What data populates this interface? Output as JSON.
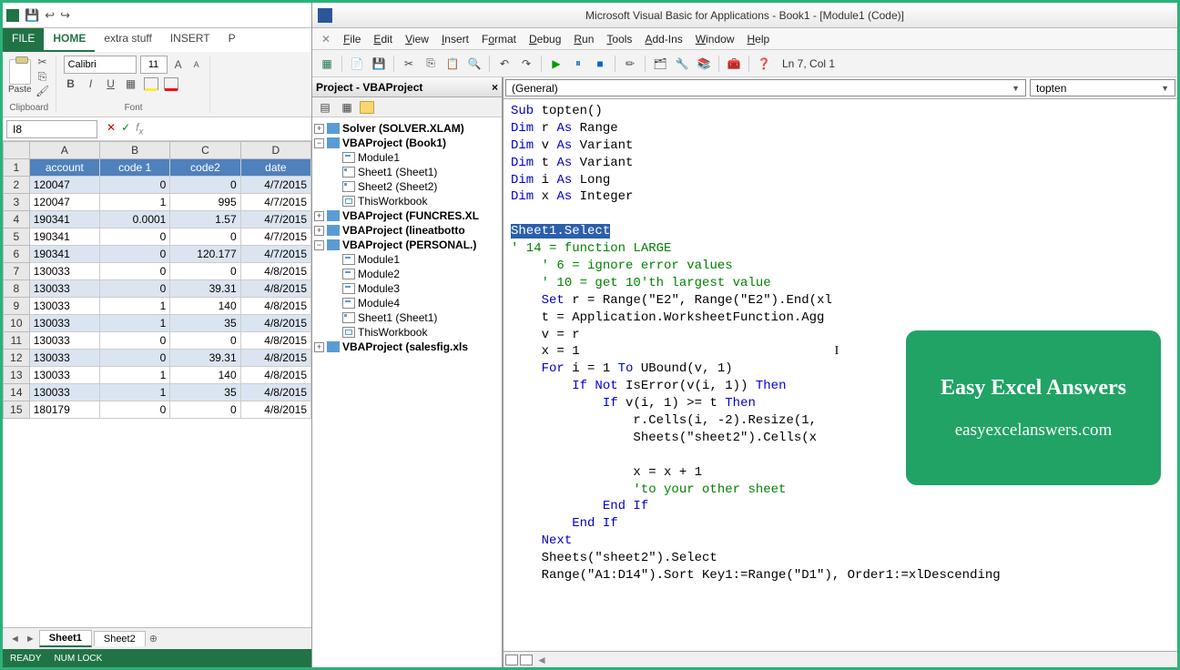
{
  "excel": {
    "qat_icons": [
      "↩",
      "↪",
      "⎘"
    ],
    "tabs": {
      "file": "FILE",
      "home": "HOME",
      "extra": "extra stuff",
      "insert": "INSERT",
      "p": "P"
    },
    "clipboard": {
      "paste": "Paste",
      "label": "Clipboard"
    },
    "font": {
      "name": "Calibri",
      "size": "11",
      "label": "Font"
    },
    "namebox": "I8",
    "columns": [
      "A",
      "B",
      "C",
      "D"
    ],
    "headers": [
      "account",
      "code 1",
      "code2",
      "date"
    ],
    "rows": [
      [
        "120047",
        "0",
        "0",
        "4/7/2015"
      ],
      [
        "120047",
        "1",
        "995",
        "4/7/2015"
      ],
      [
        "190341",
        "0.0001",
        "1.57",
        "4/7/2015"
      ],
      [
        "190341",
        "0",
        "0",
        "4/7/2015"
      ],
      [
        "190341",
        "0",
        "120.177",
        "4/7/2015"
      ],
      [
        "130033",
        "0",
        "0",
        "4/8/2015"
      ],
      [
        "130033",
        "0",
        "39.31",
        "4/8/2015"
      ],
      [
        "130033",
        "1",
        "140",
        "4/8/2015"
      ],
      [
        "130033",
        "1",
        "35",
        "4/8/2015"
      ],
      [
        "130033",
        "0",
        "0",
        "4/8/2015"
      ],
      [
        "130033",
        "0",
        "39.31",
        "4/8/2015"
      ],
      [
        "130033",
        "1",
        "140",
        "4/8/2015"
      ],
      [
        "130033",
        "1",
        "35",
        "4/8/2015"
      ],
      [
        "180179",
        "0",
        "0",
        "4/8/2015"
      ]
    ],
    "sheets": {
      "s1": "Sheet1",
      "s2": "Sheet2"
    },
    "status": {
      "ready": "READY",
      "numlock": "NUM LOCK"
    }
  },
  "vbe": {
    "title": "Microsoft Visual Basic for Applications - Book1 - [Module1 (Code)]",
    "menu": [
      "File",
      "Edit",
      "View",
      "Insert",
      "Format",
      "Debug",
      "Run",
      "Tools",
      "Add-Ins",
      "Window",
      "Help"
    ],
    "position": "Ln 7, Col 1",
    "project_title": "Project - VBAProject",
    "tree": {
      "solver": "Solver (SOLVER.XLAM)",
      "book1": "VBAProject (Book1)",
      "b1_mod1": "Module1",
      "b1_s1": "Sheet1 (Sheet1)",
      "b1_s2": "Sheet2 (Sheet2)",
      "b1_twb": "ThisWorkbook",
      "funcres": "VBAProject (FUNCRES.XL",
      "lineat": "VBAProject (lineatbotto",
      "personal": "VBAProject (PERSONAL.)",
      "p_m1": "Module1",
      "p_m2": "Module2",
      "p_m3": "Module3",
      "p_m4": "Module4",
      "p_s1": "Sheet1 (Sheet1)",
      "p_twb": "ThisWorkbook",
      "salesfig": "VBAProject (salesfig.xls"
    },
    "dd": {
      "left": "(General)",
      "right": "topten"
    },
    "code": {
      "l1": "Sub topten()",
      "l2": "Dim r As Range",
      "l3": "Dim v As Variant",
      "l4": "Dim t As Variant",
      "l5": "Dim i As Long",
      "l6": "Dim x As Integer",
      "l7": "Sheet1.Select",
      "l8": "' 14 = function LARGE",
      "l9": "'  6 = ignore error values",
      "l10": "' 10 = get 10'th largest value",
      "l11a": "Set r = Range(\"E2\", Range(\"E2\").End(xl",
      "l12a": "t = Application.WorksheetFunction.Agg",
      "l13": "v = r",
      "l14": "x = 1",
      "l15": "For i = 1 To UBound(v, 1)",
      "l16": "If Not IsError(v(i, 1)) Then",
      "l17": "If v(i, 1) >= t Then",
      "l18": "r.Cells(i, -2).Resize(1,",
      "l19": "Sheets(\"sheet2\").Cells(x",
      "l20": "x = x + 1",
      "l21": "'to your other sheet",
      "l22": "End If",
      "l23": "End If",
      "l24": "Next",
      "l25": "Sheets(\"sheet2\").Select",
      "l26": "Range(\"A1:D14\").Sort Key1:=Range(\"D1\"), Order1:=xlDescending"
    }
  },
  "brand": {
    "t1": "Easy Excel Answers",
    "t2": "easyexcelanswers.com"
  }
}
